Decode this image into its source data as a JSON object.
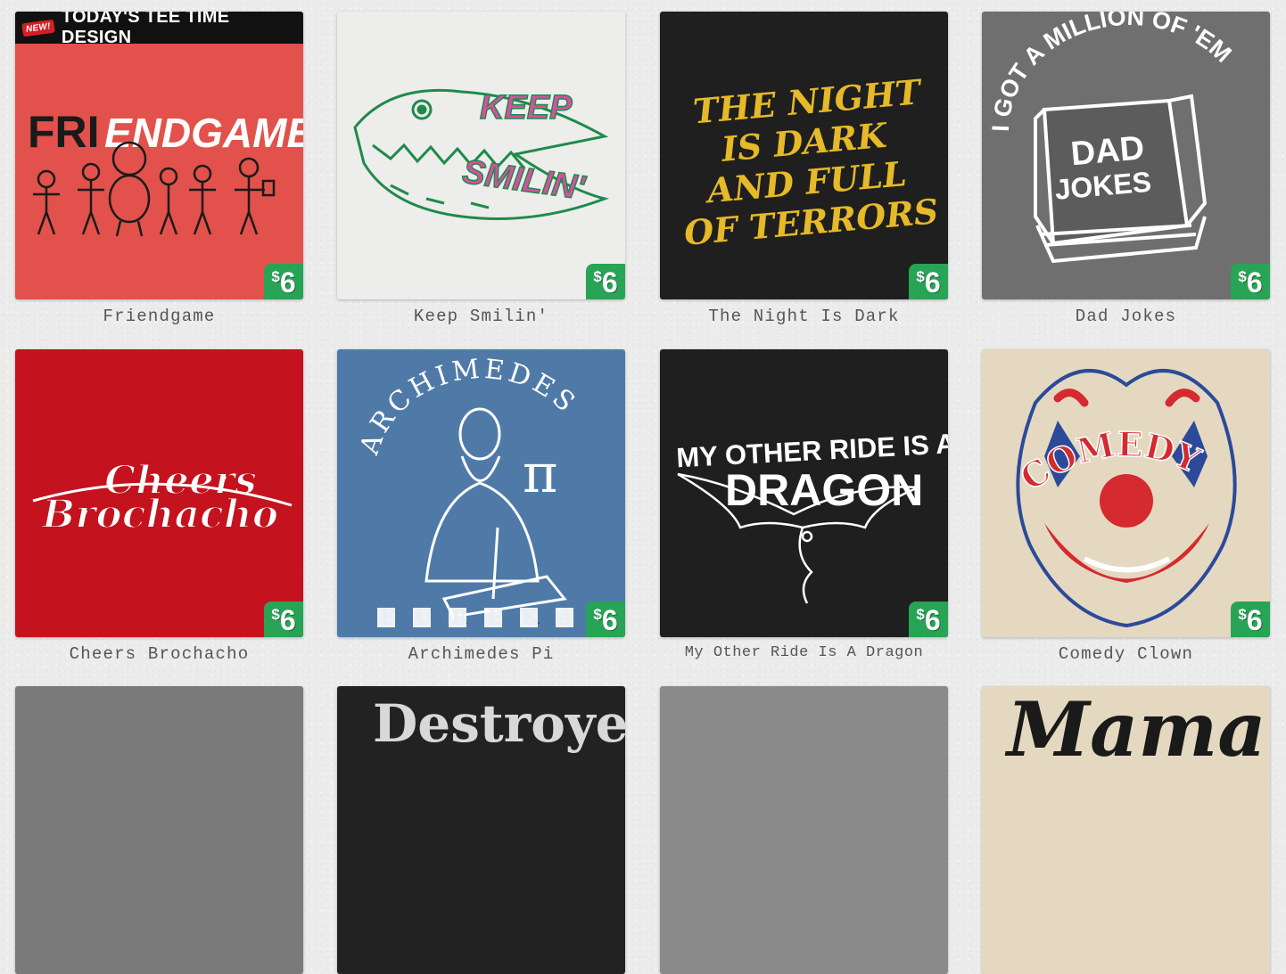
{
  "featured_banner": {
    "badge": "NEW!",
    "text": "TODAY'S TEE TIME DESIGN"
  },
  "price": {
    "currency": "$",
    "amount": "6"
  },
  "products": [
    {
      "title": "Friendgame",
      "art_text": [
        "FRI",
        "ENDGAME"
      ],
      "bg": "#e2514b"
    },
    {
      "title": "Keep Smilin'",
      "art_text": [
        "KEEP",
        "SMILIN'"
      ],
      "bg": "#ededeb"
    },
    {
      "title": "The Night Is Dark",
      "art_text": [
        "THE NIGHT",
        "IS DARK",
        "AND FULL",
        "OF TERRORS"
      ],
      "bg": "#1f1f1f"
    },
    {
      "title": "Dad Jokes",
      "art_text": [
        "I GOT A MILLION OF 'EM",
        "DAD",
        "JOKES"
      ],
      "bg": "#6f6f6f"
    },
    {
      "title": "Cheers Brochacho",
      "art_text": [
        "Cheers",
        "Brochacho"
      ],
      "bg": "#c4131e"
    },
    {
      "title": "Archimedes Pi",
      "art_text": [
        "ARCHIMEDES",
        "π",
        "EUREKA"
      ],
      "bg": "#4f7aa8"
    },
    {
      "title": "My Other Ride Is A Dragon",
      "art_text": [
        "MY OTHER RIDE IS A",
        "DRAGON"
      ],
      "bg": "#1f1f1f"
    },
    {
      "title": "Comedy Clown",
      "art_text": [
        "COMEDY"
      ],
      "bg": "#e4d9c0"
    },
    {
      "title": "",
      "art_text": [],
      "bg": "#7a7a7a"
    },
    {
      "title": "",
      "art_text": [
        "Destroyer"
      ],
      "bg": "#222222"
    },
    {
      "title": "",
      "art_text": [],
      "bg": "#8a8a8a"
    },
    {
      "title": "",
      "art_text": [
        "Mama"
      ],
      "bg": "#e4d9c0"
    }
  ]
}
